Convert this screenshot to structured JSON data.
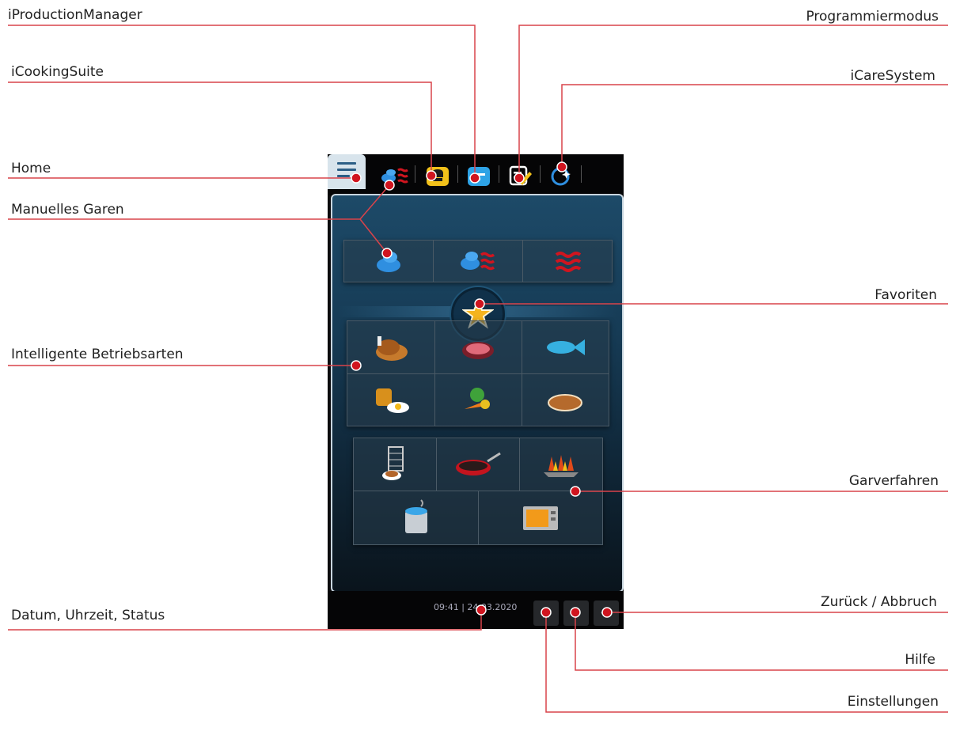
{
  "labels": {
    "production_manager": "iProductionManager",
    "cooking_suite": "iCookingSuite",
    "home": "Home",
    "manual_cooking": "Manuelles Garen",
    "intelligent_modes": "Intelligente Betriebsarten",
    "date_time_status": "Datum, Uhrzeit, Status",
    "programming_mode": "Programmiermodus",
    "care_system": "iCareSystem",
    "favorites": "Favoriten",
    "cooking_methods": "Garverfahren",
    "back_cancel": "Zurück / Abbruch",
    "help": "Hilfe",
    "settings": "Einstellungen"
  },
  "screen": {
    "datetime": "09:41 | 24.03.2020"
  },
  "colors": {
    "callout_line": "#d9434a",
    "callout_dot": "#d0151f",
    "panel_bg": "#163b55"
  },
  "icons": {
    "tabs": [
      "home-icon",
      "manual-cooking-icon",
      "icookingsuite-icon",
      "iproductionmanager-icon",
      "programming-icon",
      "icaresystem-icon"
    ],
    "manual_modes": [
      "steam-icon",
      "combi-steam-icon",
      "convection-icon"
    ],
    "intelligent_modes": [
      "poultry-icon",
      "meat-icon",
      "fish-icon",
      "egg-dessert-icon",
      "vegetables-icon",
      "bakery-icon"
    ],
    "cooking_methods": [
      "finishing-icon",
      "pan-frying-icon",
      "grilling-icon",
      "boiling-icon",
      "baking-oven-icon"
    ],
    "bottom": [
      "settings-icon",
      "help-icon",
      "back-icon"
    ]
  }
}
